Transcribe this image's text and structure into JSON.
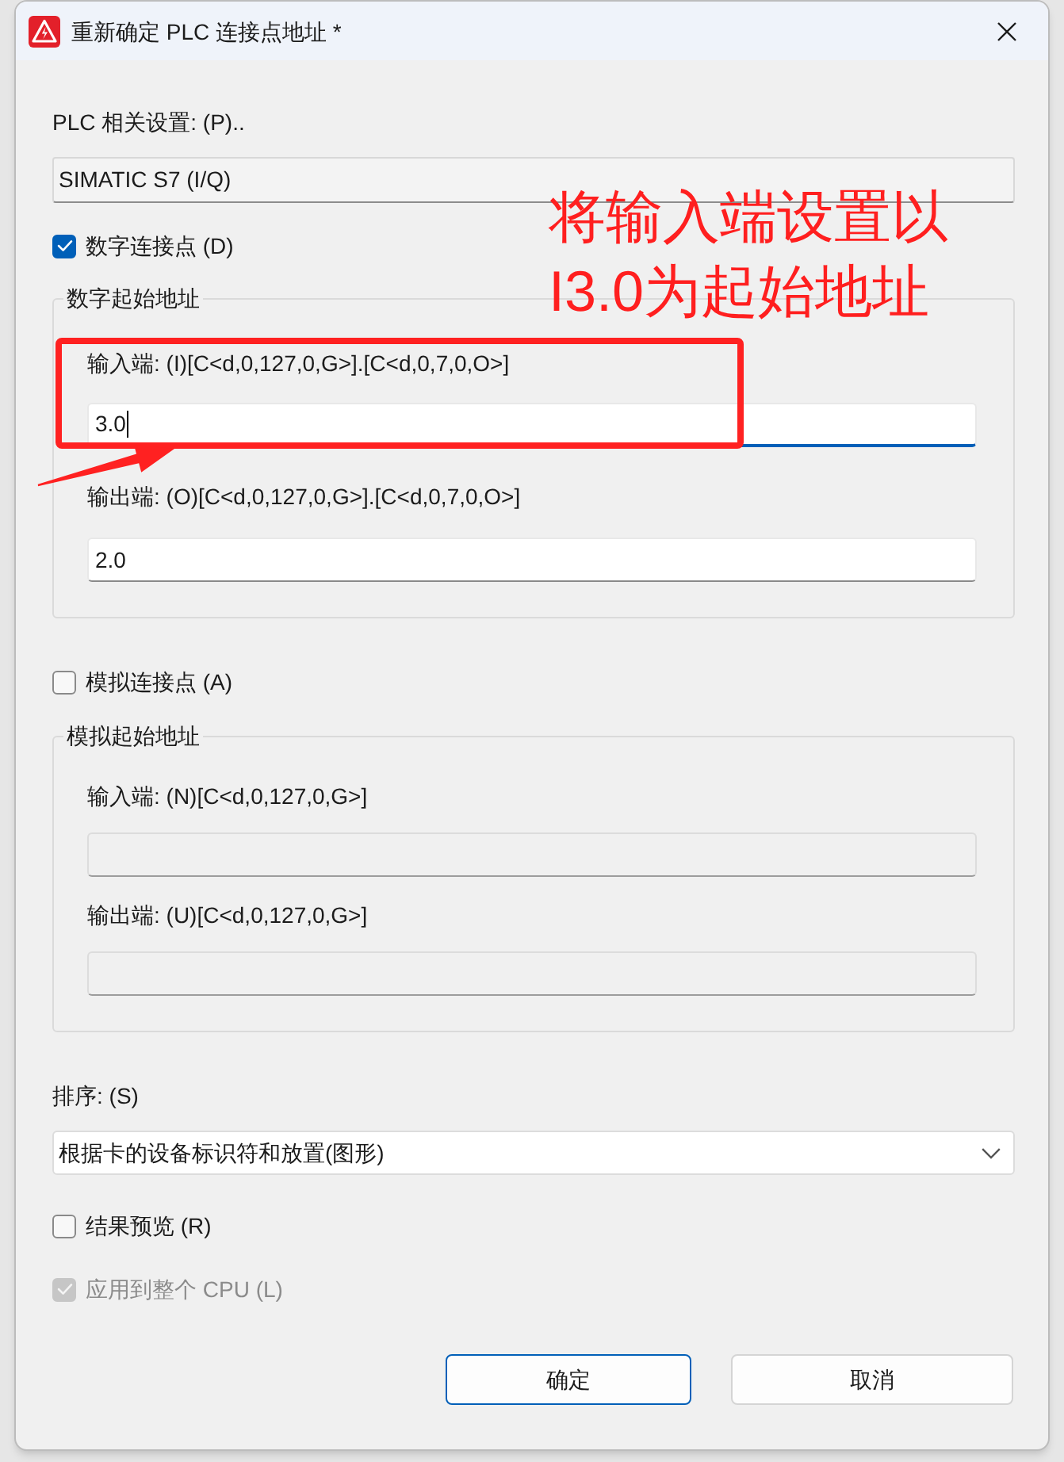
{
  "window": {
    "title": "重新确定 PLC 连接点地址 *"
  },
  "plc_settings": {
    "label": "PLC 相关设置: (P)..",
    "value": "SIMATIC S7 (I/Q)"
  },
  "digital": {
    "checkbox": {
      "label": "数字连接点 (D)",
      "checked": true,
      "disabled": false
    },
    "group_title": "数字起始地址",
    "fields": [
      {
        "label": "输入端: (I)[C<d,0,127,0,G>].[C<d,0,7,0,O>]",
        "value": "3.0",
        "focused": true,
        "disabled": false
      },
      {
        "label": "输出端: (O)[C<d,0,127,0,G>].[C<d,0,7,0,O>]",
        "value": "2.0",
        "focused": false,
        "disabled": false
      }
    ]
  },
  "analog": {
    "checkbox": {
      "label": "模拟连接点 (A)",
      "checked": false,
      "disabled": false
    },
    "group_title": "模拟起始地址",
    "fields": [
      {
        "label": "输入端: (N)[C<d,0,127,0,G>]",
        "focused": false,
        "disabled": true
      },
      {
        "label": "输出端: (U)[C<d,0,127,0,G>]",
        "focused": false,
        "disabled": true
      }
    ]
  },
  "sort": {
    "label": "排序: (S)",
    "value": "根据卡的设备标识符和放置(图形)"
  },
  "options": [
    {
      "label": "结果预览 (R)",
      "checked": false,
      "disabled": false
    },
    {
      "label": "应用到整个 CPU (L)",
      "checked": true,
      "disabled": true
    }
  ],
  "buttons": [
    {
      "label": "确定",
      "default": true
    },
    {
      "label": "取消",
      "default": false
    }
  ],
  "annotation": {
    "lines": [
      "将输入端设置以",
      "I3.0为起始地址"
    ]
  }
}
